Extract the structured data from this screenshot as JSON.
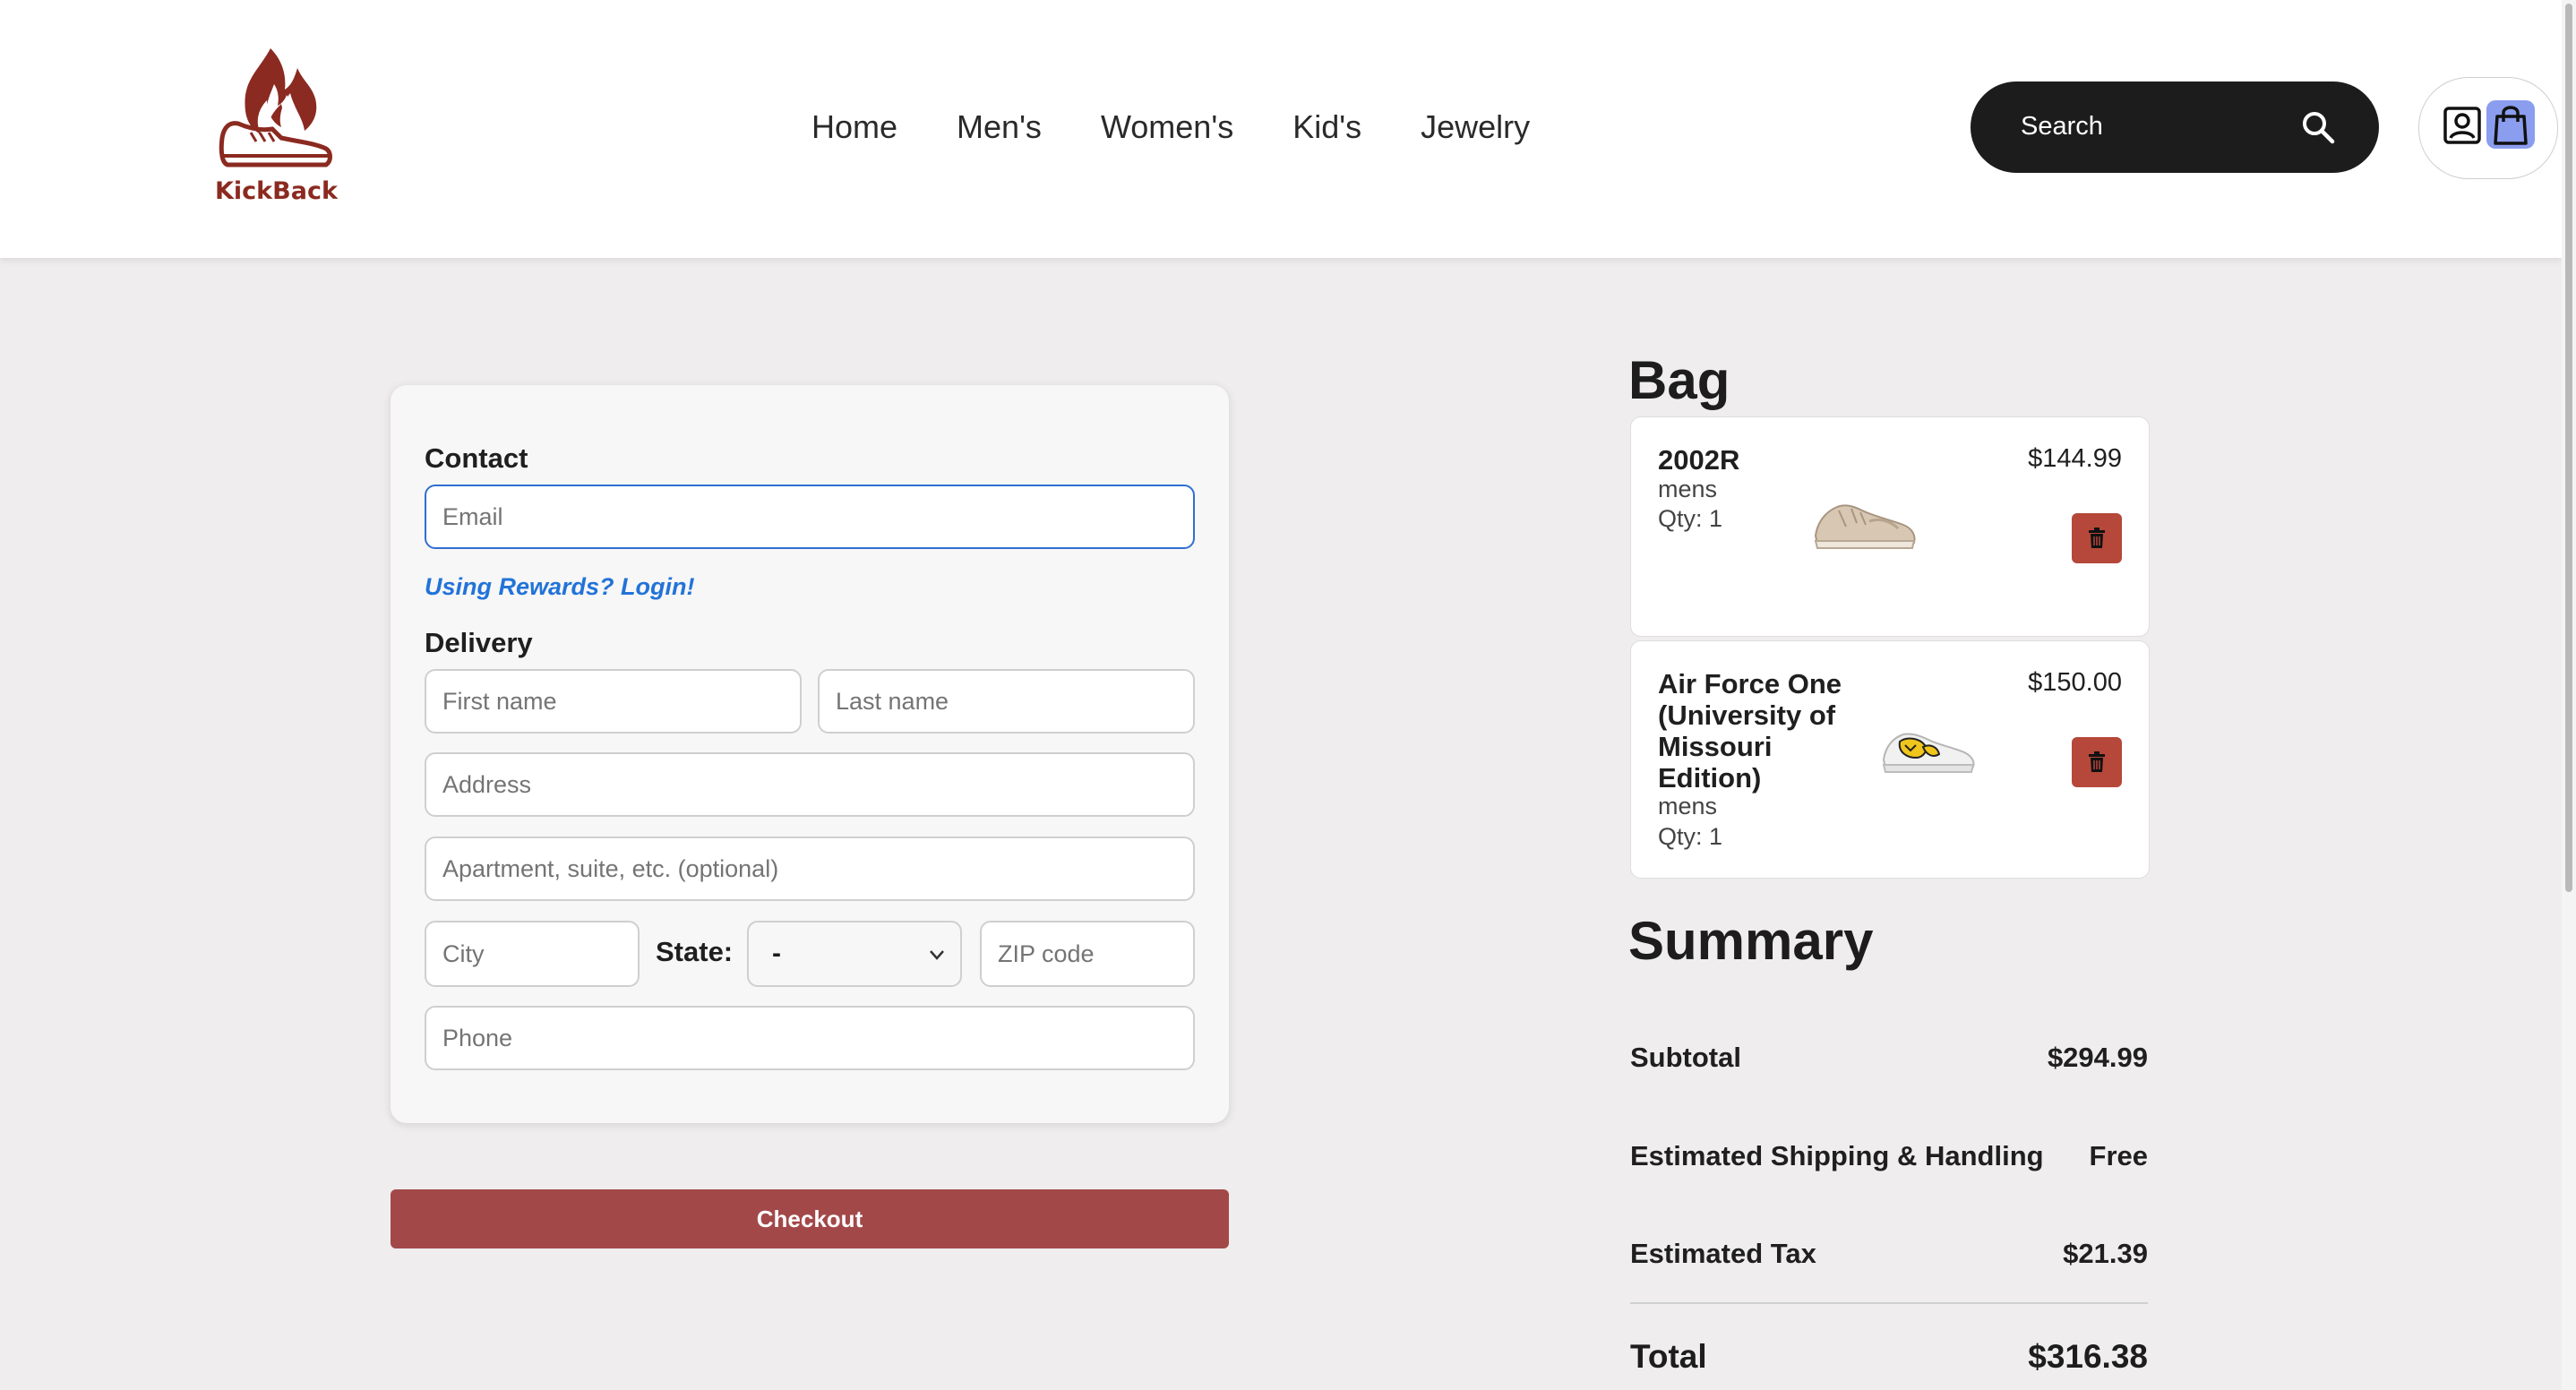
{
  "header": {
    "logo_text": "KickBack",
    "nav": [
      "Home",
      "Men's",
      "Women's",
      "Kid's",
      "Jewelry"
    ],
    "search_label": "Search",
    "accent_color": "#8b2a20"
  },
  "form": {
    "contact_label": "Contact",
    "email_placeholder": "Email",
    "rewards_link": "Using Rewards? Login!",
    "delivery_label": "Delivery",
    "first_name_placeholder": "First name",
    "last_name_placeholder": "Last name",
    "address_placeholder": "Address",
    "apartment_placeholder": "Apartment, suite, etc. (optional)",
    "city_placeholder": "City",
    "state_label": "State:",
    "state_value": "-",
    "zip_placeholder": "ZIP code",
    "phone_placeholder": "Phone",
    "checkout_label": "Checkout"
  },
  "bag": {
    "title": "Bag",
    "items": [
      {
        "name": "2002R",
        "category": "mens",
        "qty": "Qty: 1",
        "price": "$144.99"
      },
      {
        "name": "Air Force One (University of Missouri Edition)",
        "category": "mens",
        "qty": "Qty: 1",
        "price": "$150.00"
      }
    ]
  },
  "summary": {
    "title": "Summary",
    "subtotal_label": "Subtotal",
    "subtotal_value": "$294.99",
    "shipping_label": "Estimated Shipping & Handling",
    "shipping_value": "Free",
    "tax_label": "Estimated Tax",
    "tax_value": "$21.39",
    "total_label": "Total",
    "total_value": "$316.38"
  }
}
